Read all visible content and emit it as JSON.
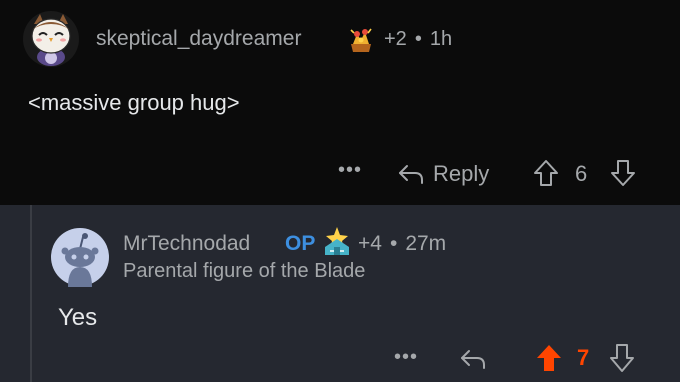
{
  "colors": {
    "background_top": "#0b0b0b",
    "background_reply": "#252830",
    "text_muted": "#a5a8ab",
    "text_body": "#e6e8ea",
    "op_blue": "#3d8fe0",
    "upvote_orange": "#ff4500"
  },
  "parent_comment": {
    "avatar_icon": "owl-avatar-icon",
    "username": "skeptical_daydreamer",
    "award_icon": "treasure-award-icon",
    "award_count": "+2",
    "separator": "•",
    "time": "1h",
    "body": "<massive group hug>",
    "more_label": "•••",
    "reply_label": "Reply",
    "score": "6",
    "voted": "none"
  },
  "reply_comment": {
    "avatar_icon": "snoo-avatar-icon",
    "username": "MrTechnodad",
    "op_label": "OP",
    "award_icon": "temple-award-icon",
    "award_count": "+4",
    "separator": "•",
    "time": "27m",
    "flair": "Parental figure of the Blade",
    "body": "Yes",
    "more_label": "•••",
    "score": "7",
    "voted": "up"
  }
}
